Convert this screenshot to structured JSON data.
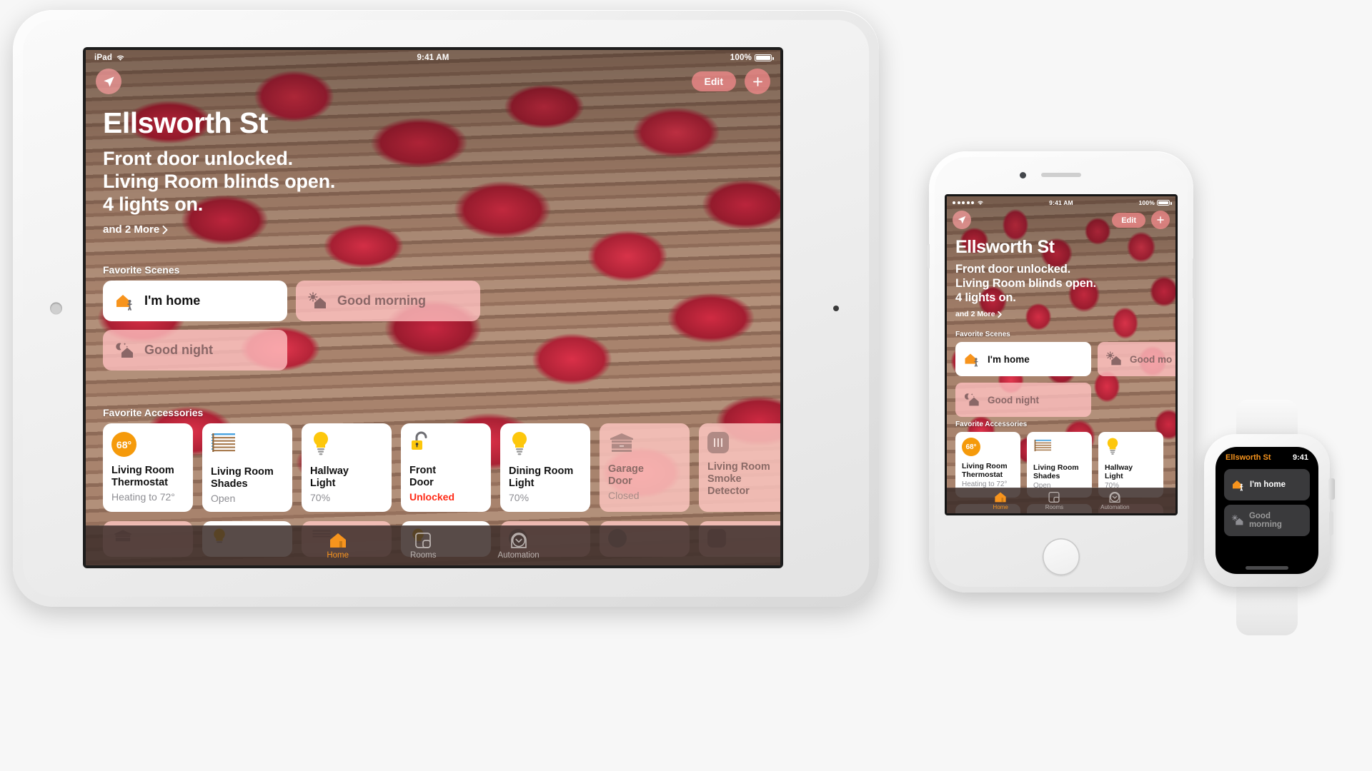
{
  "devices": {
    "ipad": {
      "status_bar": {
        "carrier": "iPad",
        "wifi_icon": "wifi-icon",
        "time": "9:41 AM",
        "battery_percent": "100%",
        "battery_icon": "battery-full-icon"
      },
      "toolbar": {
        "location_icon": "location-arrow-icon",
        "edit_label": "Edit",
        "add_icon": "plus-icon"
      },
      "header": {
        "title": "Ellsworth St",
        "status_lines": [
          "Front door unlocked.",
          "Living Room blinds open.",
          "4 lights on."
        ],
        "more_label": "and 2 More",
        "more_chevron_icon": "chevron-right-icon"
      },
      "sections": {
        "scenes_label": "Favorite Scenes",
        "accessories_label": "Favorite Accessories"
      },
      "scenes": [
        {
          "label": "I'm home",
          "icon": "house-person-icon",
          "active": true
        },
        {
          "label": "Good morning",
          "icon": "sun-house-icon",
          "active": false
        },
        {
          "label": "Good night",
          "icon": "moon-stars-house-icon",
          "active": false
        }
      ],
      "accessories": [
        {
          "name": "Living Room\nThermostat",
          "state": "Heating to 72°",
          "icon": "thermostat-icon",
          "badge": "68°",
          "active": true,
          "alert": false
        },
        {
          "name": "Living Room\nShades",
          "state": "Open",
          "icon": "blinds-icon",
          "active": true,
          "alert": false
        },
        {
          "name": "Hallway\nLight",
          "state": "70%",
          "icon": "lightbulb-icon",
          "active": true,
          "alert": false
        },
        {
          "name": "Front\nDoor",
          "state": "Unlocked",
          "icon": "unlocked-padlock-icon",
          "active": true,
          "alert": true
        },
        {
          "name": "Dining Room\nLight",
          "state": "70%",
          "icon": "lightbulb-icon",
          "active": true,
          "alert": false
        },
        {
          "name": "Garage\nDoor",
          "state": "Closed",
          "icon": "garage-door-icon",
          "active": false,
          "alert": false
        },
        {
          "name": "Living Room\nSmoke Detector",
          "state": "",
          "icon": "smoke-detector-icon",
          "active": false,
          "alert": false
        }
      ],
      "tabs": [
        {
          "label": "Home",
          "icon": "house-icon",
          "active": true
        },
        {
          "label": "Rooms",
          "icon": "rooms-icon",
          "active": false
        },
        {
          "label": "Automation",
          "icon": "automation-clock-icon",
          "active": false
        }
      ]
    },
    "iphone": {
      "status_bar": {
        "signal_icon": "signal-dots-icon",
        "wifi_icon": "wifi-icon",
        "time": "9:41 AM",
        "battery_percent": "100%",
        "battery_icon": "battery-full-icon"
      },
      "toolbar": {
        "location_icon": "location-arrow-icon",
        "edit_label": "Edit",
        "add_icon": "plus-icon"
      },
      "header": {
        "title": "Ellsworth St",
        "status_lines": [
          "Front door unlocked.",
          "Living Room blinds open.",
          "4 lights on."
        ],
        "more_label": "and 2 More",
        "more_chevron_icon": "chevron-right-icon"
      },
      "sections": {
        "scenes_label": "Favorite Scenes",
        "accessories_label": "Favorite Accessories"
      },
      "scenes": [
        {
          "label": "I'm home",
          "icon": "house-person-icon",
          "active": true
        },
        {
          "label": "Good mo",
          "icon": "sun-house-icon",
          "active": false
        },
        {
          "label": "Good night",
          "icon": "moon-stars-house-icon",
          "active": false
        }
      ],
      "accessories": [
        {
          "name": "Living Room\nThermostat",
          "state": "Heating to 72°",
          "icon": "thermostat-icon",
          "badge": "68°",
          "active": true,
          "alert": false
        },
        {
          "name": "Living Room\nShades",
          "state": "Open",
          "icon": "blinds-icon",
          "active": true,
          "alert": false
        },
        {
          "name": "Hallway\nLight",
          "state": "70%",
          "icon": "lightbulb-icon",
          "active": true,
          "alert": false
        }
      ],
      "tabs": [
        {
          "label": "Home",
          "icon": "house-icon",
          "active": true
        },
        {
          "label": "Rooms",
          "icon": "rooms-icon",
          "active": false
        },
        {
          "label": "Automation",
          "icon": "automation-clock-icon",
          "active": false
        }
      ]
    },
    "watch": {
      "title": "Ellsworth St",
      "time": "9:41",
      "scenes": [
        {
          "label": "I'm home",
          "icon": "house-person-icon",
          "active": true
        },
        {
          "label": "Good morning",
          "icon": "sun-house-icon",
          "active": false
        }
      ]
    }
  },
  "colors": {
    "accent_orange": "#f7941d",
    "alert_red": "#ff2b17",
    "pill_pink": "#ec8888",
    "tile_dim_pink": "#fac4be",
    "bulb_yellow": "#fdc70c",
    "state_gray": "#8e8e93"
  }
}
